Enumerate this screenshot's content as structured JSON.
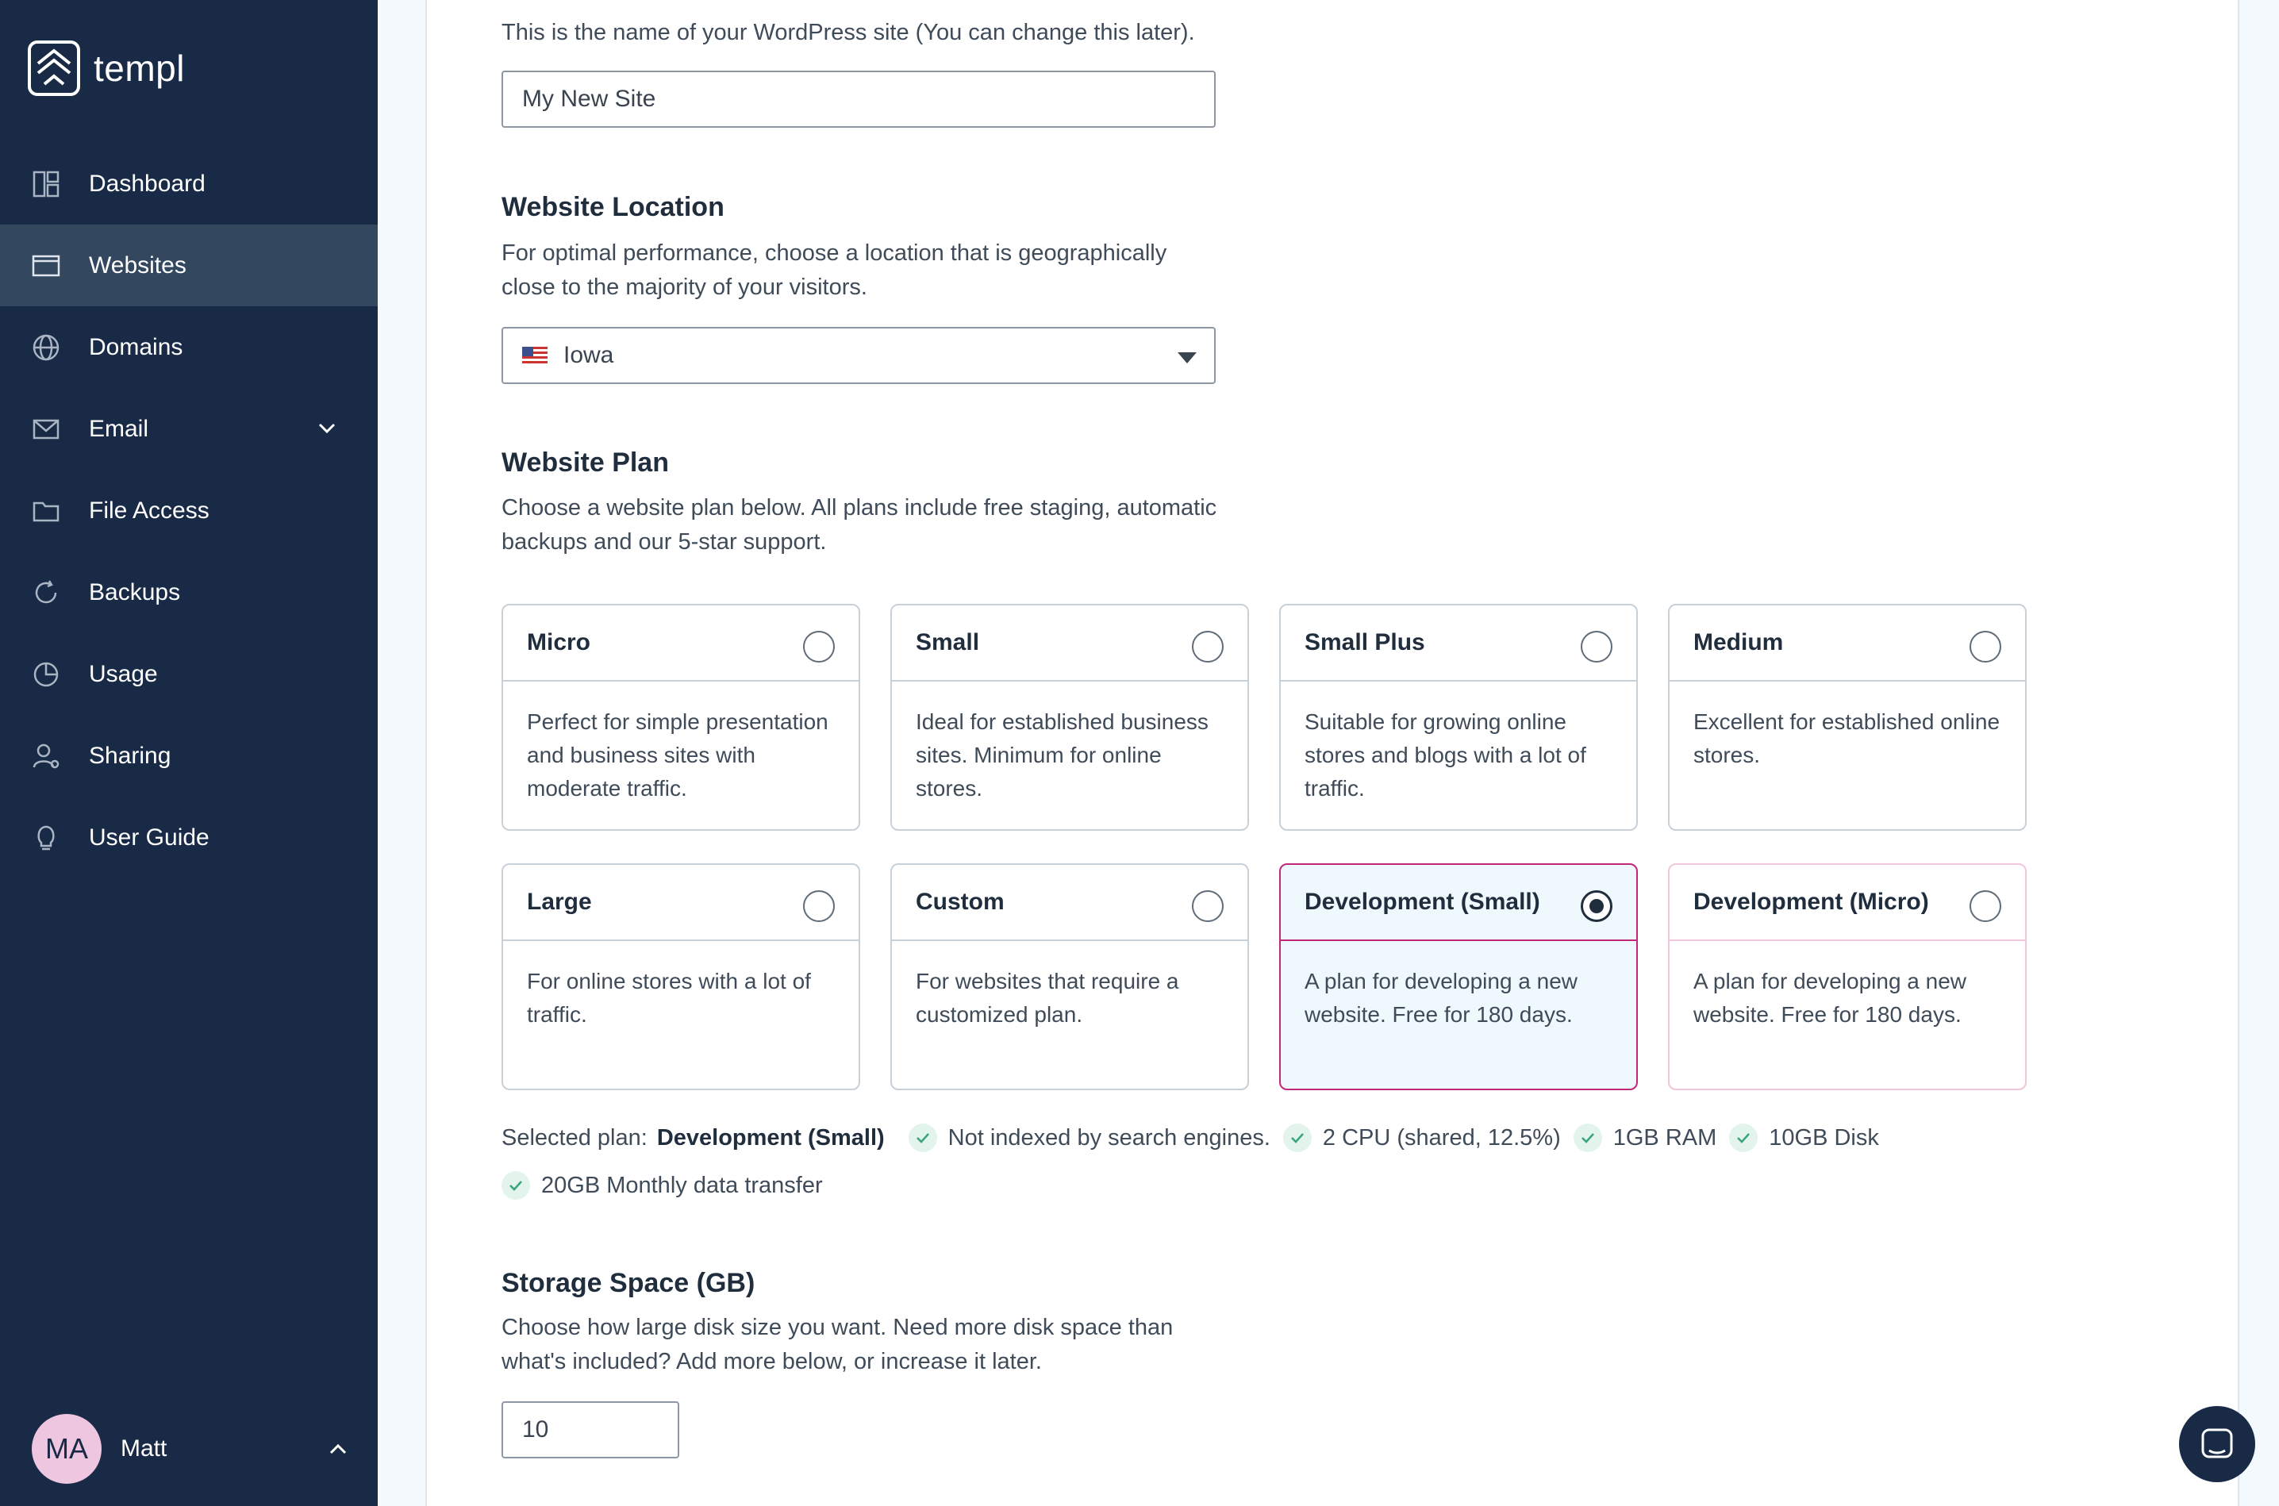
{
  "app": {
    "name": "templ"
  },
  "sidebar": {
    "items": [
      {
        "label": "Dashboard",
        "icon": "dashboard-icon",
        "active": false
      },
      {
        "label": "Websites",
        "icon": "browser-window-icon",
        "active": true
      },
      {
        "label": "Domains",
        "icon": "globe-icon",
        "active": false
      },
      {
        "label": "Email",
        "icon": "envelope-icon",
        "active": false,
        "expandable": true
      },
      {
        "label": "File Access",
        "icon": "folder-icon",
        "active": false
      },
      {
        "label": "Backups",
        "icon": "refresh-icon",
        "active": false
      },
      {
        "label": "Usage",
        "icon": "pie-chart-icon",
        "active": false
      },
      {
        "label": "Sharing",
        "icon": "user-share-icon",
        "active": false
      },
      {
        "label": "User Guide",
        "icon": "lightbulb-icon",
        "active": false
      }
    ],
    "user": {
      "initials": "MA",
      "name": "Matt"
    }
  },
  "form": {
    "site_name": {
      "help": "This is the name of your WordPress site (You can change this later).",
      "value": "My New Site"
    },
    "location": {
      "title": "Website Location",
      "help": "For optimal performance, choose a location that is geographically close to the majority of your visitors.",
      "value": "Iowa",
      "flag": "us-flag-icon"
    },
    "plan": {
      "title": "Website Plan",
      "help": "Choose a website plan below. All plans include free staging, automatic backups and our 5-star support.",
      "options": [
        {
          "name": "Micro",
          "description": "Perfect for simple presentation and business sites with moderate traffic.",
          "selected": false
        },
        {
          "name": "Small",
          "description": "Ideal for established business sites. Minimum for online stores.",
          "selected": false
        },
        {
          "name": "Small Plus",
          "description": "Suitable for growing online stores and blogs with a lot of traffic.",
          "selected": false
        },
        {
          "name": "Medium",
          "description": "Excellent for established online stores.",
          "selected": false
        },
        {
          "name": "Large",
          "description": "For online stores with a lot of traffic.",
          "selected": false
        },
        {
          "name": "Custom",
          "description": "For websites that require a customized plan.",
          "selected": false
        },
        {
          "name": "Development (Small)",
          "description": "A plan for developing a new website. Free for 180 days.",
          "selected": true
        },
        {
          "name": "Development (Micro)",
          "description": "A plan for developing a new website. Free for 180 days.",
          "selected": false
        }
      ],
      "selected_label": "Selected plan:",
      "selected_value": "Development (Small)",
      "features": [
        "Not indexed by search engines.",
        "2 CPU (shared, 12.5%)",
        "1GB RAM",
        "10GB Disk",
        "20GB Monthly data transfer"
      ]
    },
    "storage": {
      "title": "Storage Space (GB)",
      "help": "Choose how large disk size you want. Need more disk space than what's included? Add more below, or increase it later.",
      "value": "10"
    }
  },
  "colors": {
    "sidebar": "#182a46",
    "active": "#33475f",
    "accent": "#c0297a",
    "selected_bg": "#eef8fd"
  }
}
